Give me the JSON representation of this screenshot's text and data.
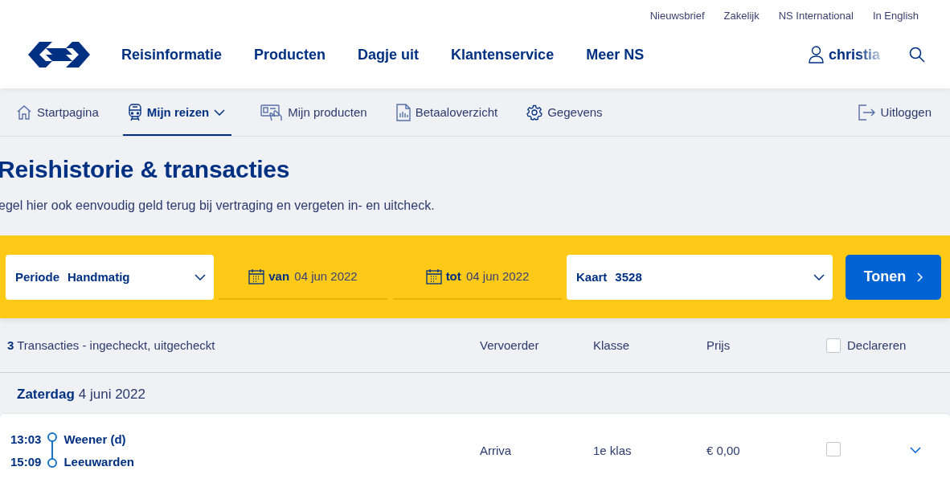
{
  "utility_links": [
    "Nieuwsbrief",
    "Zakelijk",
    "NS International",
    "In English"
  ],
  "nav": {
    "items": [
      "Reisinformatie",
      "Producten",
      "Dagje uit",
      "Klantenservice",
      "Meer NS"
    ],
    "user": "christia"
  },
  "subnav": {
    "items": [
      {
        "label": "Startpagina",
        "kind": "home",
        "selected": false,
        "dropdown": false
      },
      {
        "label": "Mijn reizen",
        "kind": "train",
        "selected": true,
        "dropdown": true
      },
      {
        "label": "Mijn producten",
        "kind": "card",
        "selected": false,
        "dropdown": false
      },
      {
        "label": "Betaaloverzicht",
        "kind": "document",
        "selected": false,
        "dropdown": false
      },
      {
        "label": "Gegevens",
        "kind": "gear",
        "selected": false,
        "dropdown": false
      }
    ],
    "logout": "Uitloggen"
  },
  "page": {
    "title": "Reishistorie & transacties",
    "subtitle": "egel hier ook eenvoudig geld terug bij vertraging en vergeten in- en uitcheck."
  },
  "filters": {
    "period": {
      "label": "Periode",
      "value": "Handmatig"
    },
    "from": {
      "label": "van",
      "value": "04 jun 2022"
    },
    "to": {
      "label": "tot",
      "value": "04 jun 2022"
    },
    "card": {
      "label": "Kaart",
      "value": "3528"
    },
    "submit": "Tonen"
  },
  "table": {
    "count": "3",
    "summary": "Transacties - ingecheckt, uitgecheckt",
    "columns": [
      "Vervoerder",
      "Klasse",
      "Prijs"
    ],
    "declare": {
      "label": "Declareren",
      "checked": false
    }
  },
  "days": [
    {
      "weekday": "Zaterdag",
      "date": "4 juni 2022",
      "trips": [
        {
          "departure_time": "13:03",
          "departure_station": "Weener (d)",
          "arrival_time": "15:09",
          "arrival_station": "Leeuwarden",
          "carrier": "Arriva",
          "class": "1e klas",
          "price": "€ 0,00",
          "checked": false,
          "expanded": false
        }
      ]
    }
  ]
}
